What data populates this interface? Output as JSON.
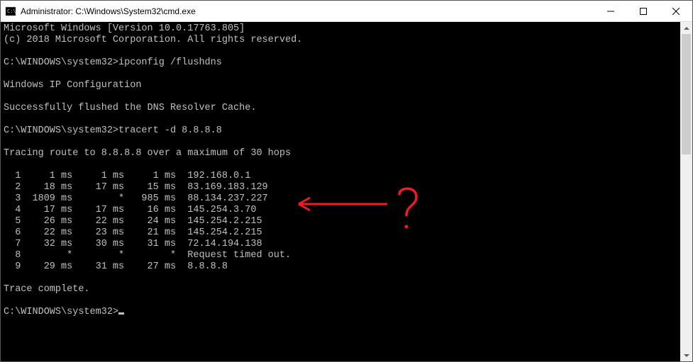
{
  "window": {
    "title": "Administrator: C:\\Windows\\System32\\cmd.exe"
  },
  "banner": {
    "l1": "Microsoft Windows [Version 10.0.17763.805]",
    "l2": "(c) 2018 Microsoft Corporation. All rights reserved."
  },
  "cmd1": {
    "prompt": "C:\\WINDOWS\\system32>",
    "command": "ipconfig /flushdns"
  },
  "ipcfg": {
    "header": "Windows IP Configuration",
    "result": "Successfully flushed the DNS Resolver Cache."
  },
  "cmd2": {
    "prompt": "C:\\WINDOWS\\system32>",
    "command": "tracert -d 8.8.8.8"
  },
  "tracert": {
    "header": "Tracing route to 8.8.8.8 over a maximum of 30 hops",
    "rows": [
      {
        "n": "1",
        "t1": "1 ms",
        "t2": "1 ms",
        "t3": "1 ms",
        "ip": "192.168.0.1"
      },
      {
        "n": "2",
        "t1": "18 ms",
        "t2": "17 ms",
        "t3": "15 ms",
        "ip": "83.169.183.129"
      },
      {
        "n": "3",
        "t1": "1809 ms",
        "t2": "*",
        "t3": "985 ms",
        "ip": "88.134.237.227"
      },
      {
        "n": "4",
        "t1": "17 ms",
        "t2": "17 ms",
        "t3": "16 ms",
        "ip": "145.254.3.70"
      },
      {
        "n": "5",
        "t1": "26 ms",
        "t2": "22 ms",
        "t3": "24 ms",
        "ip": "145.254.2.215"
      },
      {
        "n": "6",
        "t1": "22 ms",
        "t2": "23 ms",
        "t3": "21 ms",
        "ip": "145.254.2.215"
      },
      {
        "n": "7",
        "t1": "32 ms",
        "t2": "30 ms",
        "t3": "31 ms",
        "ip": "72.14.194.138"
      },
      {
        "n": "8",
        "t1": "*",
        "t2": "*",
        "t3": "*",
        "ip": "Request timed out."
      },
      {
        "n": "9",
        "t1": "29 ms",
        "t2": "31 ms",
        "t3": "27 ms",
        "ip": "8.8.8.8"
      }
    ],
    "complete": "Trace complete."
  },
  "cmd3": {
    "prompt": "C:\\WINDOWS\\system32>"
  },
  "annotation": {
    "symbol": "?",
    "color": "#ed1c24"
  }
}
